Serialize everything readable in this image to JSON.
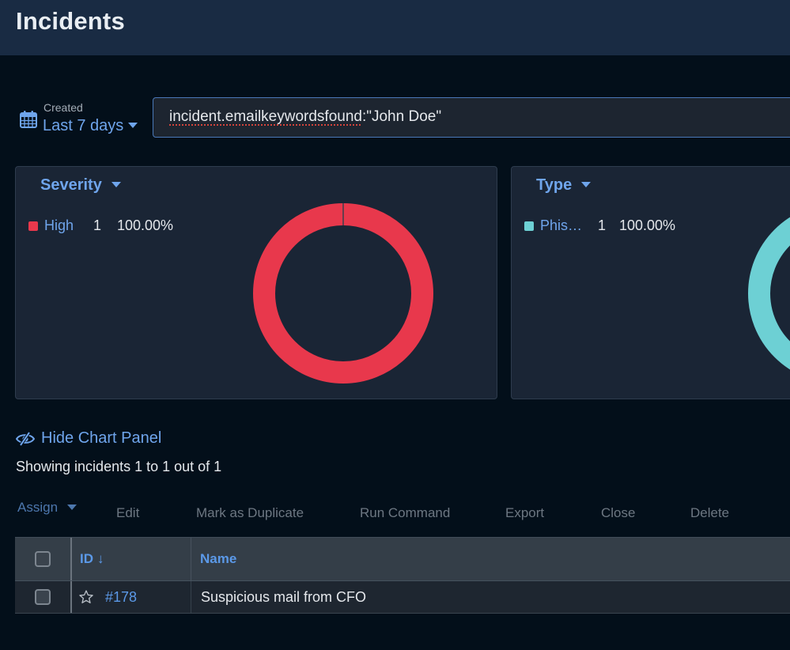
{
  "header": {
    "title": "Incidents"
  },
  "filters": {
    "date_label": "Created",
    "date_value": "Last 7 days",
    "search_query_field": "incident.emailkeywordsfound",
    "search_query_value": ":\"John Doe\""
  },
  "chart_data": [
    {
      "type": "pie",
      "title": "Severity",
      "categories": [
        "High"
      ],
      "values": [
        1
      ],
      "percentages": [
        "100.00%"
      ],
      "colors": [
        "#e8384c"
      ],
      "legend": "top-left",
      "donut": true
    },
    {
      "type": "pie",
      "title": "Type",
      "categories": [
        "Phis…"
      ],
      "values": [
        1
      ],
      "percentages": [
        "100.00%"
      ],
      "colors": [
        "#6dd0d4"
      ],
      "legend": "top-left",
      "donut": true
    }
  ],
  "charts_panel": {
    "severity": {
      "title": "Severity",
      "legend": [
        {
          "name": "High",
          "count": "1",
          "percent": "100.00%",
          "color": "#e8384c"
        }
      ]
    },
    "type": {
      "title": "Type",
      "legend": [
        {
          "name": "Phis…",
          "count": "1",
          "percent": "100.00%",
          "color": "#6dd0d4"
        }
      ]
    },
    "hide_label": "Hide Chart Panel"
  },
  "summary": {
    "showing_text": "Showing incidents 1 to 1 out of 1"
  },
  "actions": {
    "assign": "Assign",
    "edit": "Edit",
    "mark_duplicate": "Mark as Duplicate",
    "run_command": "Run Command",
    "export": "Export",
    "close": "Close",
    "delete": "Delete"
  },
  "table": {
    "columns": [
      "ID",
      "Name"
    ],
    "sort_indicator": "↓",
    "rows": [
      {
        "id": "#178",
        "name": "Suspicious mail from CFO"
      }
    ]
  },
  "colors": {
    "accent": "#6fa5ec",
    "header_bg": "#192b43",
    "page_bg": "#030f1a",
    "severity_high": "#e8384c",
    "type_phishing": "#6dd0d4"
  }
}
